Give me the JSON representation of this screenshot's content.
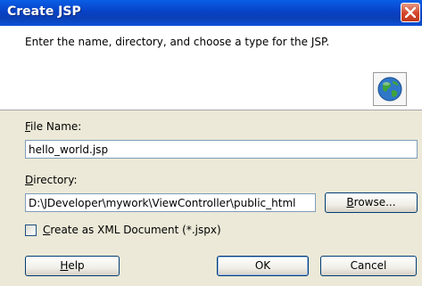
{
  "window": {
    "title": "Create JSP"
  },
  "header": {
    "description": "Enter the name, directory, and choose a type for the JSP.",
    "icon": "globe-jsp-icon"
  },
  "form": {
    "file_name": {
      "label_mnemonic": "F",
      "label_rest": "ile Name:",
      "value": "hello_world.jsp"
    },
    "directory": {
      "label_mnemonic": "D",
      "label_rest": "irectory:",
      "value": "D:\\JDeveloper\\mywork\\ViewController\\public_html"
    },
    "browse_button": {
      "mnemonic": "B",
      "rest": "rowse..."
    },
    "xml_checkbox": {
      "mnemonic": "C",
      "rest": "reate as XML Document (*.jspx)",
      "checked": false
    }
  },
  "buttons": {
    "help": {
      "mnemonic": "H",
      "rest": "elp"
    },
    "ok": "OK",
    "cancel": "Cancel"
  },
  "colors": {
    "titlebar": "#0842c6",
    "dialog_bg": "#ece9d8",
    "field_border": "#7f9db9",
    "close_button": "#d4452a"
  }
}
